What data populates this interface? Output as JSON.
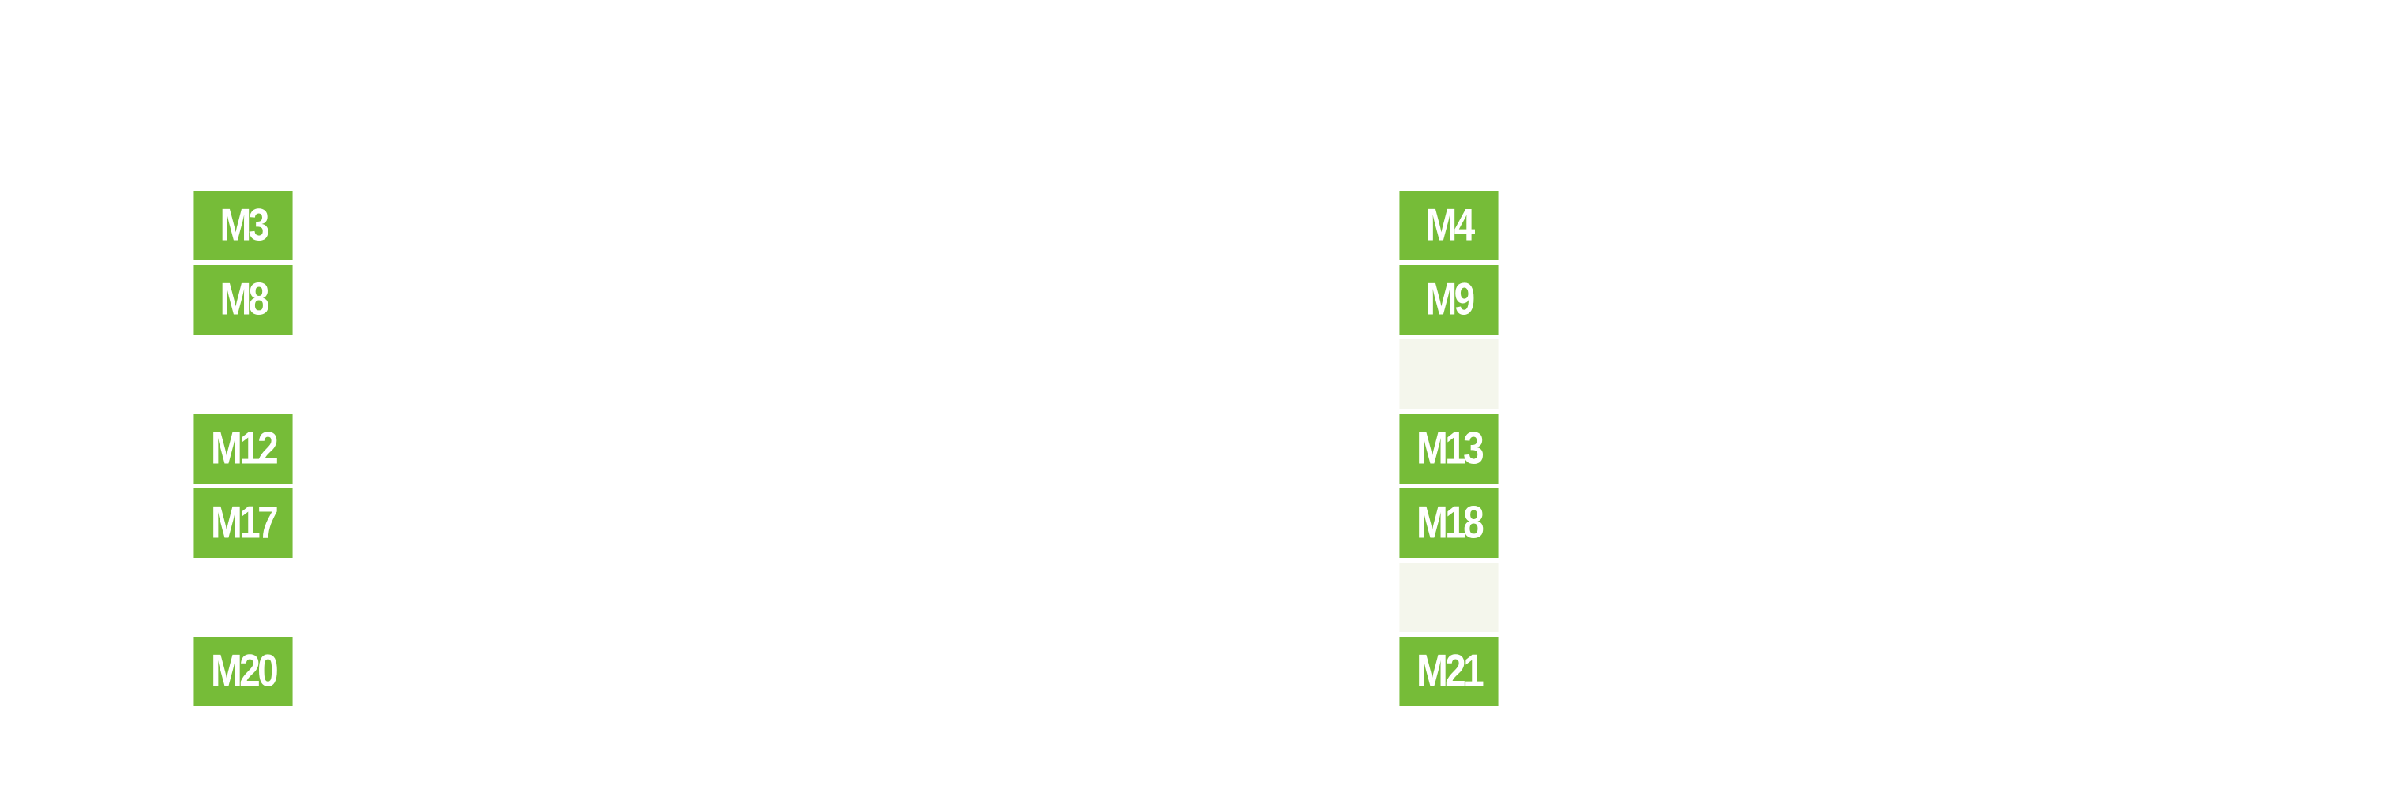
{
  "colors": {
    "filled": "#76bc38",
    "empty": "#f4f6ec",
    "text": "#ffffff",
    "background": "#ffffff"
  },
  "left_column": {
    "tiles": [
      {
        "label": "M3",
        "state": "filled"
      },
      {
        "label": "M8",
        "state": "filled"
      },
      {
        "label": "",
        "state": "none"
      },
      {
        "label": "M12",
        "state": "filled"
      },
      {
        "label": "M17",
        "state": "filled"
      },
      {
        "label": "",
        "state": "none"
      },
      {
        "label": "M20",
        "state": "filled"
      }
    ]
  },
  "right_column": {
    "tiles": [
      {
        "label": "M4",
        "state": "filled"
      },
      {
        "label": "M9",
        "state": "filled"
      },
      {
        "label": "",
        "state": "empty"
      },
      {
        "label": "M13",
        "state": "filled"
      },
      {
        "label": "M18",
        "state": "filled"
      },
      {
        "label": "",
        "state": "empty"
      },
      {
        "label": "M21",
        "state": "filled"
      }
    ]
  }
}
